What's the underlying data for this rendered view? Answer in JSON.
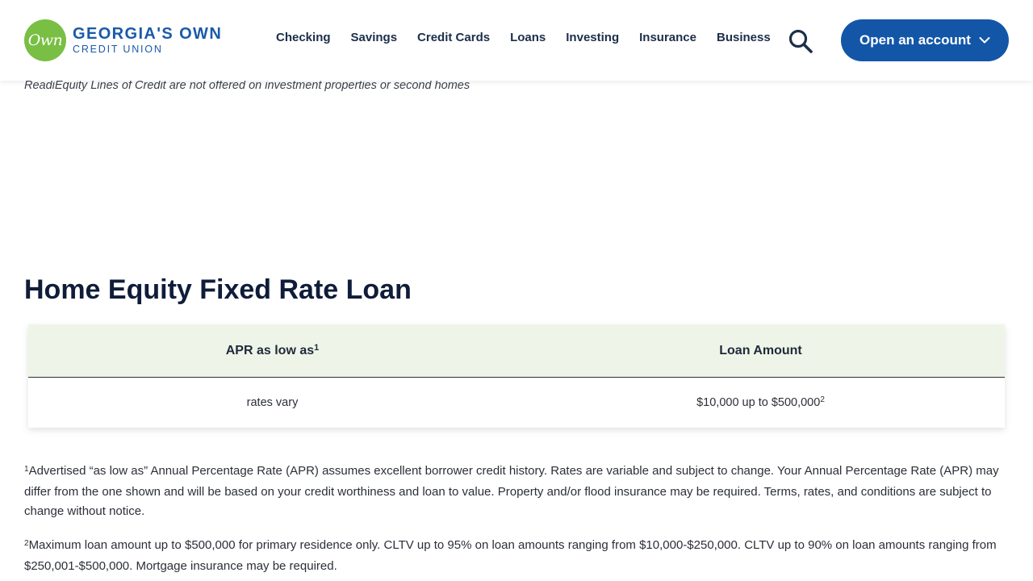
{
  "brand": {
    "logo_mark": "Own",
    "name_line1": "GEORGIA'S OWN",
    "name_line2": "CREDIT UNION",
    "color_green": "#78bf44",
    "color_blue": "#1a5aa8"
  },
  "nav": {
    "items": [
      {
        "label": "Checking"
      },
      {
        "label": "Savings"
      },
      {
        "label": "Credit Cards"
      },
      {
        "label": "Loans"
      },
      {
        "label": "Investing"
      },
      {
        "label": "Insurance"
      },
      {
        "label": "Business"
      }
    ],
    "search_icon": "search-icon",
    "cta_label": "Open an account",
    "cta_icon": "chevron-down-icon",
    "cta_color": "#1356a8"
  },
  "content": {
    "disclaimer_top": "ReadiEquity Lines of Credit are not offered on investment properties or second homes",
    "section_title": "Home Equity Fixed Rate Loan",
    "table": {
      "header_bg": "#eef5e8",
      "headers": [
        {
          "label": "APR as low as",
          "sup": "1"
        },
        {
          "label": "Loan Amount",
          "sup": ""
        }
      ],
      "rows": [
        [
          {
            "value": "rates vary",
            "sup": ""
          },
          {
            "value": "$10,000 up to $500,000",
            "sup": "2"
          }
        ]
      ]
    },
    "footnotes": [
      {
        "marker": "1",
        "text": "Advertised “as low as” Annual Percentage Rate (APR) assumes excellent borrower credit history. Rates are variable and subject to change. Your Annual Percentage Rate (APR) may differ from the one shown and will be based on your credit worthiness and loan to value. Property and/or flood insurance may be required. Terms, rates, and conditions are subject to change without notice."
      },
      {
        "marker": "2",
        "text": "Maximum loan amount up to $500,000 for primary residence only. CLTV up to 95% on loan amounts ranging from $10,000-$250,000. CLTV up to 90% on loan amounts ranging from $250,001-$500,000. Mortgage insurance may be required."
      }
    ]
  }
}
